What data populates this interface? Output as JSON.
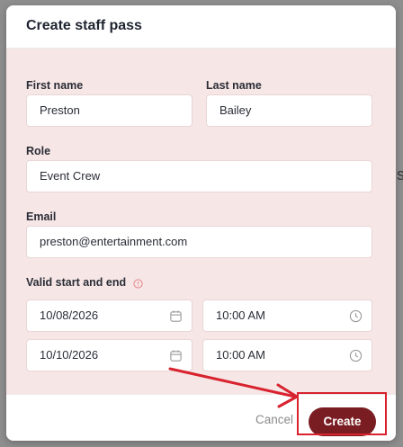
{
  "background": {
    "partial_letter": "s"
  },
  "modal": {
    "title": "Create staff pass",
    "fields": {
      "first_name": {
        "label": "First name",
        "value": "Preston"
      },
      "last_name": {
        "label": "Last name",
        "value": "Bailey"
      },
      "role": {
        "label": "Role",
        "value": "Event Crew"
      },
      "email": {
        "label": "Email",
        "value": "preston@entertainment.com"
      }
    },
    "validity": {
      "label": "Valid start and end",
      "start_date": "10/08/2026",
      "start_time": "10:00 AM",
      "end_date": "10/10/2026",
      "end_time": "10:00 AM"
    },
    "footer": {
      "cancel_label": "Cancel",
      "create_label": "Create"
    }
  },
  "colors": {
    "accent": "#7a1d22",
    "annotation": "#d8232e",
    "info": "#e4878c"
  },
  "icons": [
    "calendar-icon",
    "clock-icon",
    "info-icon"
  ]
}
